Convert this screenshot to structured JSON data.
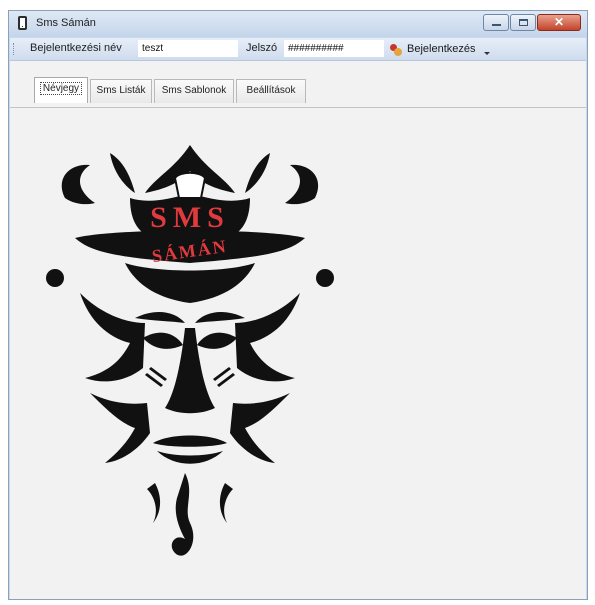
{
  "window": {
    "title": "Sms Sámán",
    "minimize_glyph": "minimize-icon",
    "maximize_glyph": "maximize-icon",
    "close_glyph": "✕"
  },
  "toolbar": {
    "username_label": "Bejelentkezési név",
    "username_value": "teszt",
    "password_label": "Jelszó",
    "password_value": "##########",
    "login_label": "Bejelentkezés",
    "login_icon": "keys-icon"
  },
  "tabs": [
    {
      "label": "Névjegy",
      "active": true
    },
    {
      "label": "Sms Listák",
      "active": false
    },
    {
      "label": "Sms Sablonok",
      "active": false
    },
    {
      "label": "Beállítások",
      "active": false
    }
  ],
  "logo": {
    "text_top": "SMS",
    "text_bottom": "SÁMÁN",
    "accent_color": "#e03a3e"
  }
}
